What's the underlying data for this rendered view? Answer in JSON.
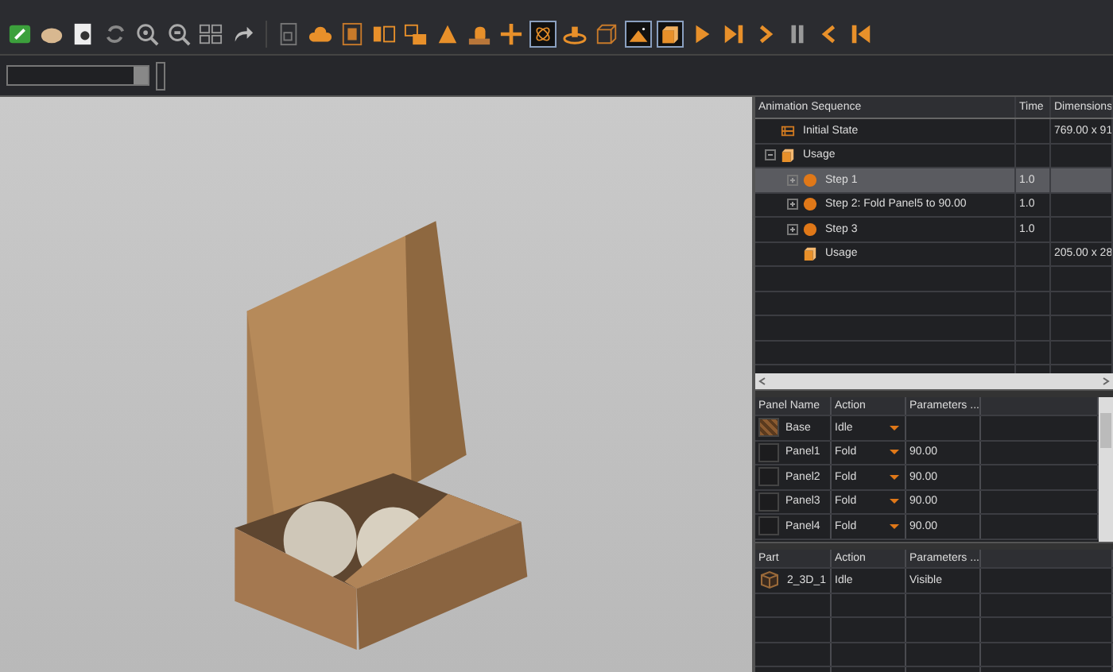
{
  "sequence": {
    "columns": [
      "Animation Sequence",
      "Time",
      "Dimensions"
    ],
    "items": [
      {
        "kind": "state",
        "name": "Initial State",
        "dimensions": "769.00 x 91",
        "selected": false
      },
      {
        "kind": "usage",
        "name": "Usage",
        "selected": false,
        "expanded": true,
        "children": [
          {
            "kind": "step",
            "name": "Step 1",
            "time": "1.0",
            "selected": true,
            "expanded": false
          },
          {
            "kind": "step",
            "name": "Step 2: Fold Panel5 to 90.00",
            "time": "1.0",
            "selected": false,
            "expanded": false
          },
          {
            "kind": "step",
            "name": "Step 3",
            "time": "1.0",
            "selected": false,
            "expanded": false
          },
          {
            "kind": "usage",
            "name": "Usage",
            "dimensions": "205.00 x 28",
            "selected": false
          }
        ]
      }
    ]
  },
  "panels": {
    "columns": [
      "Panel Name",
      "Action",
      "Parameters ..."
    ],
    "rows": [
      {
        "kind": "base",
        "name": "Base",
        "action": "Idle"
      },
      {
        "kind": "panel",
        "name": "Panel1",
        "action": "Fold",
        "parameters": "90.00"
      },
      {
        "kind": "panel",
        "name": "Panel2",
        "action": "Fold",
        "parameters": "90.00"
      },
      {
        "kind": "panel",
        "name": "Panel3",
        "action": "Fold",
        "parameters": "90.00"
      },
      {
        "kind": "panel",
        "name": "Panel4",
        "action": "Fold",
        "parameters": "90.00"
      }
    ]
  },
  "parts": {
    "columns": [
      "Part",
      "Action",
      "Parameters ..."
    ],
    "rows": [
      {
        "name": "2_3D_1",
        "action": "Idle",
        "parameters": "Visible"
      }
    ]
  }
}
